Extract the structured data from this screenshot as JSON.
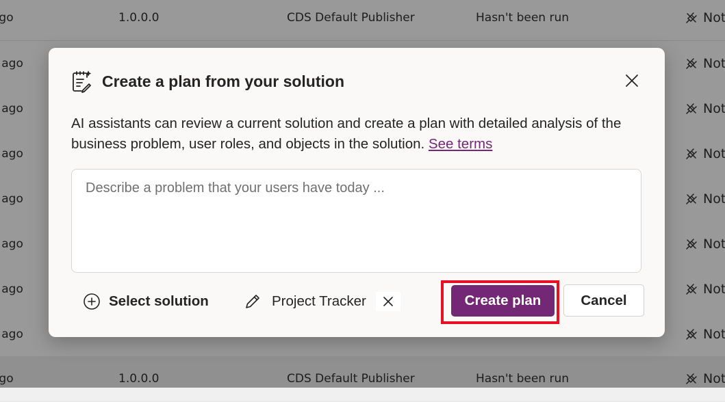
{
  "background_table": {
    "rows": [
      {
        "modified": "ago",
        "version": "1.0.0.0",
        "publisher": "CDS Default Publisher",
        "status": "Hasn't been run",
        "managed": "Not"
      },
      {
        "modified": "s ago",
        "version": "",
        "publisher": "",
        "status": "",
        "managed": "Not"
      },
      {
        "modified": "s ago",
        "version": "",
        "publisher": "",
        "status": "",
        "managed": "Not"
      },
      {
        "modified": "s ago",
        "version": "",
        "publisher": "",
        "status": "",
        "managed": "Not"
      },
      {
        "modified": "s ago",
        "version": "",
        "publisher": "",
        "status": "",
        "managed": "Not"
      },
      {
        "modified": "s ago",
        "version": "",
        "publisher": "",
        "status": "",
        "managed": "Not"
      },
      {
        "modified": "s ago",
        "version": "",
        "publisher": "",
        "status": "",
        "managed": "Not"
      },
      {
        "modified": "s ago",
        "version": "",
        "publisher": "",
        "status": "",
        "managed": "Not"
      },
      {
        "modified": "ago",
        "version": "1.0.0.0",
        "publisher": "CDS Default Publisher",
        "status": "Hasn't been run",
        "managed": "Not"
      }
    ],
    "managed_icon": "unplugged-icon"
  },
  "dialog": {
    "title": "Create a plan from your solution",
    "title_icon": "ai-plan-icon",
    "close_icon": "close-icon",
    "description": "AI assistants can review a current solution and create a plan with detailed analysis of the business problem, user roles, and objects in the solution.",
    "terms_link": "See terms",
    "prompt_placeholder": "Describe a problem that your users have today ...",
    "prompt_value": "",
    "select_solution_label": "Select solution",
    "select_solution_icon": "add-circle-icon",
    "selected_solution": {
      "name": "Project Tracker",
      "icon": "pencil-icon",
      "remove_icon": "dismiss-icon"
    },
    "primary_button": "Create plan",
    "secondary_button": "Cancel",
    "accent_color": "#742774",
    "highlight_color": "#e81123"
  }
}
